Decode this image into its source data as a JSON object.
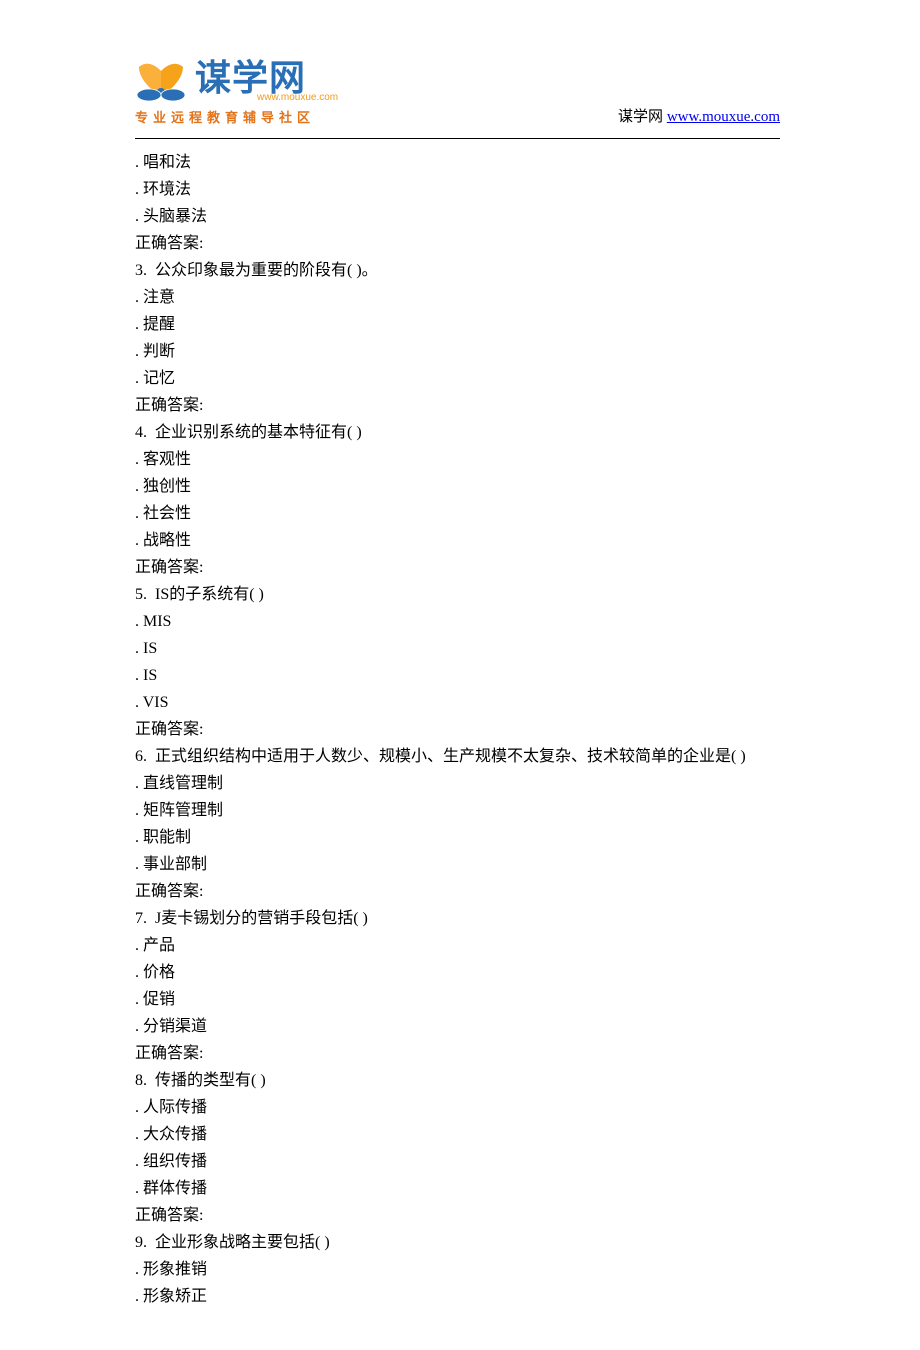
{
  "header": {
    "logo_main": "谋学网",
    "logo_sub": "www.mouxue.com",
    "logo_tagline": "专业远程教育辅导社区",
    "site_label": "谋学网",
    "site_url": "www.mouxue.com",
    "site_href": "http://www.mouxue.com"
  },
  "lines": [
    ". 唱和法",
    ". 环境法",
    ". 头脑暴法",
    "正确答案:",
    "3.  公众印象最为重要的阶段有( )。",
    ". 注意",
    ". 提醒",
    ". 判断",
    ". 记忆",
    "正确答案:",
    "4.  企业识别系统的基本特征有( )",
    ". 客观性",
    ". 独创性",
    ". 社会性",
    ". 战略性",
    "正确答案:",
    "5.  IS的子系统有( )",
    ". MIS",
    ". IS",
    ". IS",
    ". VIS",
    "正确答案:",
    "6.  正式组织结构中适用于人数少、规模小、生产规模不太复杂、技术较简单的企业是( )",
    ". 直线管理制",
    ". 矩阵管理制",
    ". 职能制",
    ". 事业部制",
    "正确答案:",
    "7.  J麦卡锡划分的营销手段包括( )",
    ". 产品",
    ". 价格",
    ". 促销",
    ". 分销渠道",
    "正确答案:",
    "8.  传播的类型有( )",
    ". 人际传播",
    ". 大众传播",
    ". 组织传播",
    ". 群体传播",
    "正确答案:",
    "9.  企业形象战略主要包括( )",
    ". 形象推销",
    ". 形象矫正"
  ]
}
